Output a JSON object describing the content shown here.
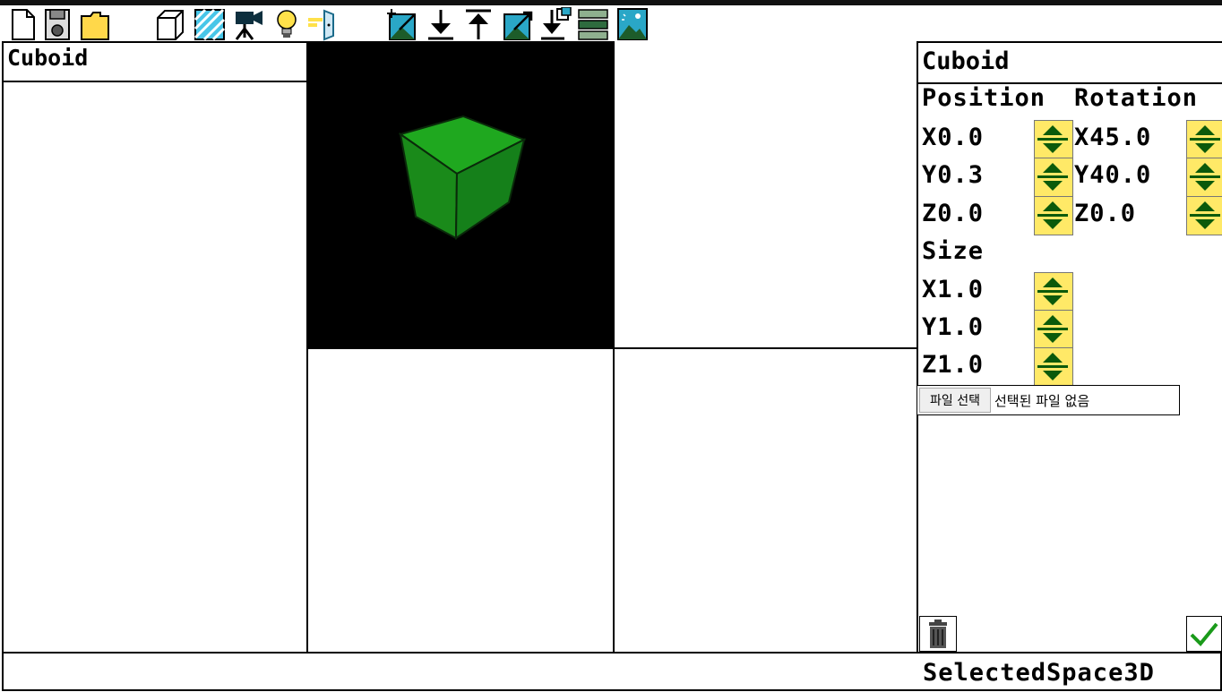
{
  "toolbar": {
    "tools": [
      {
        "name": "new-file-icon"
      },
      {
        "name": "save-icon"
      },
      {
        "name": "open-folder-icon"
      },
      {
        "name": "cube-icon"
      },
      {
        "name": "texture-icon"
      },
      {
        "name": "camera-icon"
      },
      {
        "name": "light-bulb-icon"
      },
      {
        "name": "door-icon"
      },
      {
        "name": "import-image-icon"
      },
      {
        "name": "arrow-down-icon"
      },
      {
        "name": "arrow-up-icon"
      },
      {
        "name": "export-image-icon"
      },
      {
        "name": "move-down-layer-icon"
      },
      {
        "name": "layers-icon"
      },
      {
        "name": "landscape-image-icon"
      }
    ]
  },
  "outliner": {
    "title": "Cuboid"
  },
  "viewport": {
    "background": "#000000",
    "object_color": "#1a9a1a"
  },
  "properties": {
    "title": "Cuboid",
    "position_label": "Position",
    "rotation_label": "Rotation",
    "size_label": "Size",
    "position": {
      "x": "X0.0",
      "y": "Y0.3",
      "z": "Z0.0"
    },
    "rotation": {
      "x": "X45.0",
      "y": "Y40.0",
      "z": "Z0.0"
    },
    "size": {
      "x": "X1.0",
      "y": "Y1.0",
      "z": "Z1.0"
    }
  },
  "file_input": {
    "button_label": "파일 선택",
    "status": "선택된 파일 없음"
  },
  "status_bar": {
    "text": "SelectedSpace3D"
  },
  "colors": {
    "stepper_bg": "#ffe967",
    "stepper_arrow": "#0b5a0b",
    "accent_green": "#1a9a1a"
  }
}
